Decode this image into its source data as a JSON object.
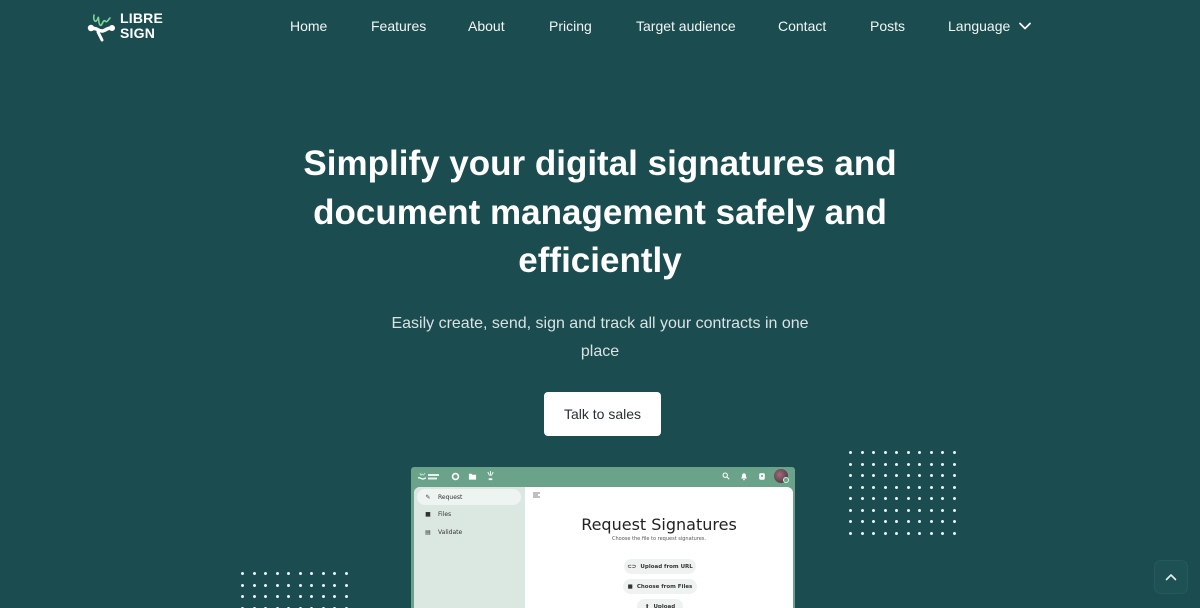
{
  "brand": {
    "name_line1": "LIBRE",
    "name_line2": "SIGN",
    "accent_color": "#7ed49a",
    "background_color": "#1b4c4f"
  },
  "nav": {
    "items": [
      {
        "label": "Home"
      },
      {
        "label": "Features"
      },
      {
        "label": "About"
      },
      {
        "label": "Pricing"
      },
      {
        "label": "Target audience"
      },
      {
        "label": "Contact"
      },
      {
        "label": "Posts"
      },
      {
        "label": "Language"
      }
    ],
    "language_icon": "chevron-down-icon"
  },
  "hero": {
    "title_lines": [
      "Simplify your digital signatures and",
      "document management safely and",
      "efficiently"
    ],
    "subtitle_lines": [
      "Easily create, send, sign and track all your contracts in one",
      "place"
    ],
    "cta_label": "Talk to sales"
  },
  "app_preview": {
    "top_icons": [
      "libresign-logo",
      "circle-icon",
      "folder-icon",
      "libresign-app-icon",
      "search-icon",
      "bell-icon",
      "contacts-icon",
      "avatar"
    ],
    "sidebar": [
      {
        "label": "Request",
        "icon": "pencil-icon",
        "active": true
      },
      {
        "label": "Files",
        "icon": "folder-icon",
        "active": false
      },
      {
        "label": "Validate",
        "icon": "document-icon",
        "active": false
      }
    ],
    "menu_icon": "menu-toggle-icon",
    "title": "Request Signatures",
    "description": "Choose the file to request signatures.",
    "buttons": [
      {
        "label": "Upload from URL",
        "icon": "link-icon"
      },
      {
        "label": "Choose from Files",
        "icon": "folder-icon"
      },
      {
        "label": "Upload",
        "icon": "upload-icon"
      }
    ]
  },
  "back_to_top_icon": "chevron-up-icon"
}
